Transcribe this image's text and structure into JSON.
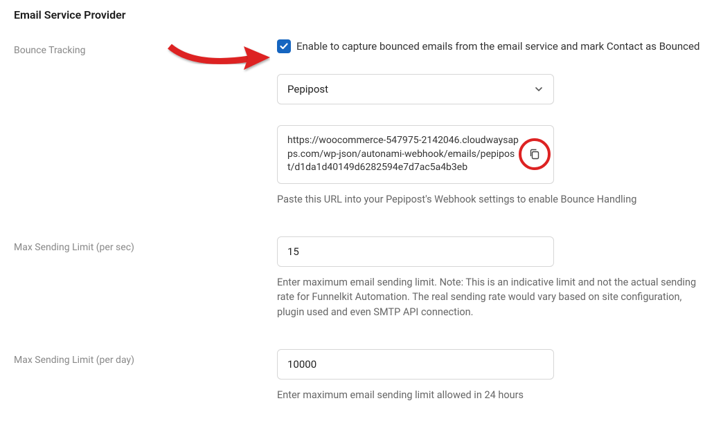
{
  "section": {
    "title": "Email Service Provider"
  },
  "bounce": {
    "label": "Bounce Tracking",
    "checkbox_label": "Enable to capture bounced emails from the email service and mark Contact as Bounced",
    "select_value": "Pepipost",
    "webhook_url": "https://woocommerce-547975-2142046.cloudwaysapps.com/wp-json/autonami-webhook/emails/pepipost/d1da1d40149d6282594e7d7ac5a4b3eb",
    "webhook_help": "Paste this URL into your Pepipost's Webhook settings to enable Bounce Handling"
  },
  "max_per_sec": {
    "label": "Max Sending Limit (per sec)",
    "value": "15",
    "help": "Enter maximum email sending limit. Note: This is an indicative limit and not the actual sending rate for Funnelkit Automation. The real sending rate would vary based on site configuration, plugin used and even SMTP API connection."
  },
  "max_per_day": {
    "label": "Max Sending Limit (per day)",
    "value": "10000",
    "help": "Enter maximum email sending limit allowed in 24 hours"
  }
}
